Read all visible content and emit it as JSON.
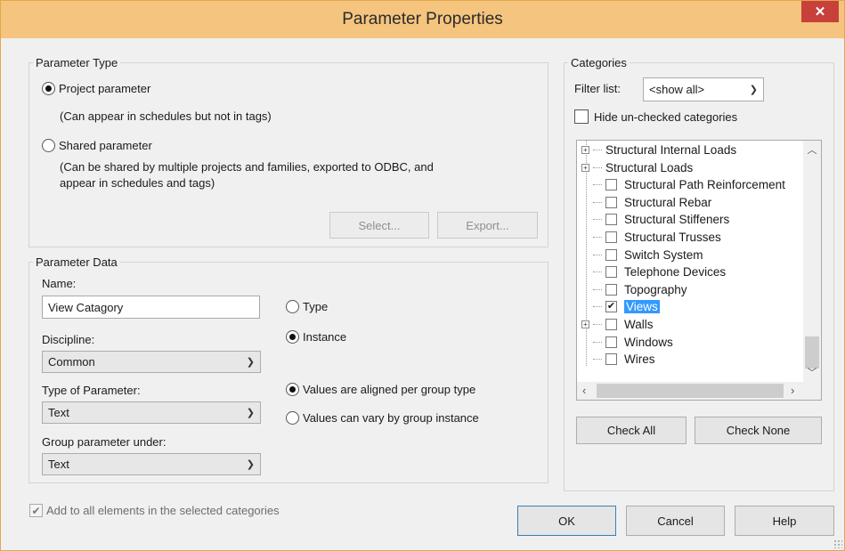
{
  "window": {
    "title": "Parameter Properties",
    "close_glyph": "✕"
  },
  "parameter_type": {
    "legend": "Parameter Type",
    "project_label": "Project parameter",
    "project_hint": "(Can appear in schedules but not in tags)",
    "shared_label": "Shared parameter",
    "shared_hint_line1": "(Can be shared by multiple projects and families, exported to ODBC, and",
    "shared_hint_line2": "appear in schedules and tags)",
    "selected": "project",
    "select_button": "Select...",
    "export_button": "Export..."
  },
  "parameter_data": {
    "legend": "Parameter Data",
    "name_label": "Name:",
    "name_value": "View Catagory",
    "discipline_label": "Discipline:",
    "discipline_value": "Common",
    "type_label": "Type of Parameter:",
    "type_value": "Text",
    "group_label": "Group parameter under:",
    "group_value": "Text",
    "type_radio": "Type",
    "instance_radio": "Instance",
    "aligned_radio": "Values are aligned per group type",
    "vary_radio": "Values can vary by group instance"
  },
  "categories": {
    "legend": "Categories",
    "filter_label": "Filter list:",
    "filter_value": "<show all>",
    "hide_unchecked_label": "Hide un-checked categories",
    "items": [
      {
        "label": "Structural Internal Loads",
        "expandable": true,
        "checkbox": false,
        "checked": false,
        "selected": false
      },
      {
        "label": "Structural Loads",
        "expandable": true,
        "checkbox": false,
        "checked": false,
        "selected": false
      },
      {
        "label": "Structural Path Reinforcement",
        "expandable": false,
        "checkbox": true,
        "checked": false,
        "selected": false
      },
      {
        "label": "Structural Rebar",
        "expandable": false,
        "checkbox": true,
        "checked": false,
        "selected": false
      },
      {
        "label": "Structural Stiffeners",
        "expandable": false,
        "checkbox": true,
        "checked": false,
        "selected": false
      },
      {
        "label": "Structural Trusses",
        "expandable": false,
        "checkbox": true,
        "checked": false,
        "selected": false
      },
      {
        "label": "Switch System",
        "expandable": false,
        "checkbox": true,
        "checked": false,
        "selected": false
      },
      {
        "label": "Telephone Devices",
        "expandable": false,
        "checkbox": true,
        "checked": false,
        "selected": false
      },
      {
        "label": "Topography",
        "expandable": false,
        "checkbox": true,
        "checked": false,
        "selected": false
      },
      {
        "label": "Views",
        "expandable": false,
        "checkbox": true,
        "checked": true,
        "selected": true
      },
      {
        "label": "Walls",
        "expandable": true,
        "checkbox": true,
        "checked": false,
        "selected": false
      },
      {
        "label": "Windows",
        "expandable": false,
        "checkbox": true,
        "checked": false,
        "selected": false
      },
      {
        "label": "Wires",
        "expandable": false,
        "checkbox": true,
        "checked": false,
        "selected": false
      }
    ],
    "check_all_button": "Check All",
    "check_none_button": "Check None"
  },
  "footer": {
    "add_to_all_label": "Add to all elements in the selected categories",
    "add_to_all_checked": true,
    "ok_button": "OK",
    "cancel_button": "Cancel",
    "help_button": "Help"
  },
  "colors": {
    "titlebar": "#f5c47e",
    "close": "#c7403a",
    "selection": "#3399ff"
  }
}
